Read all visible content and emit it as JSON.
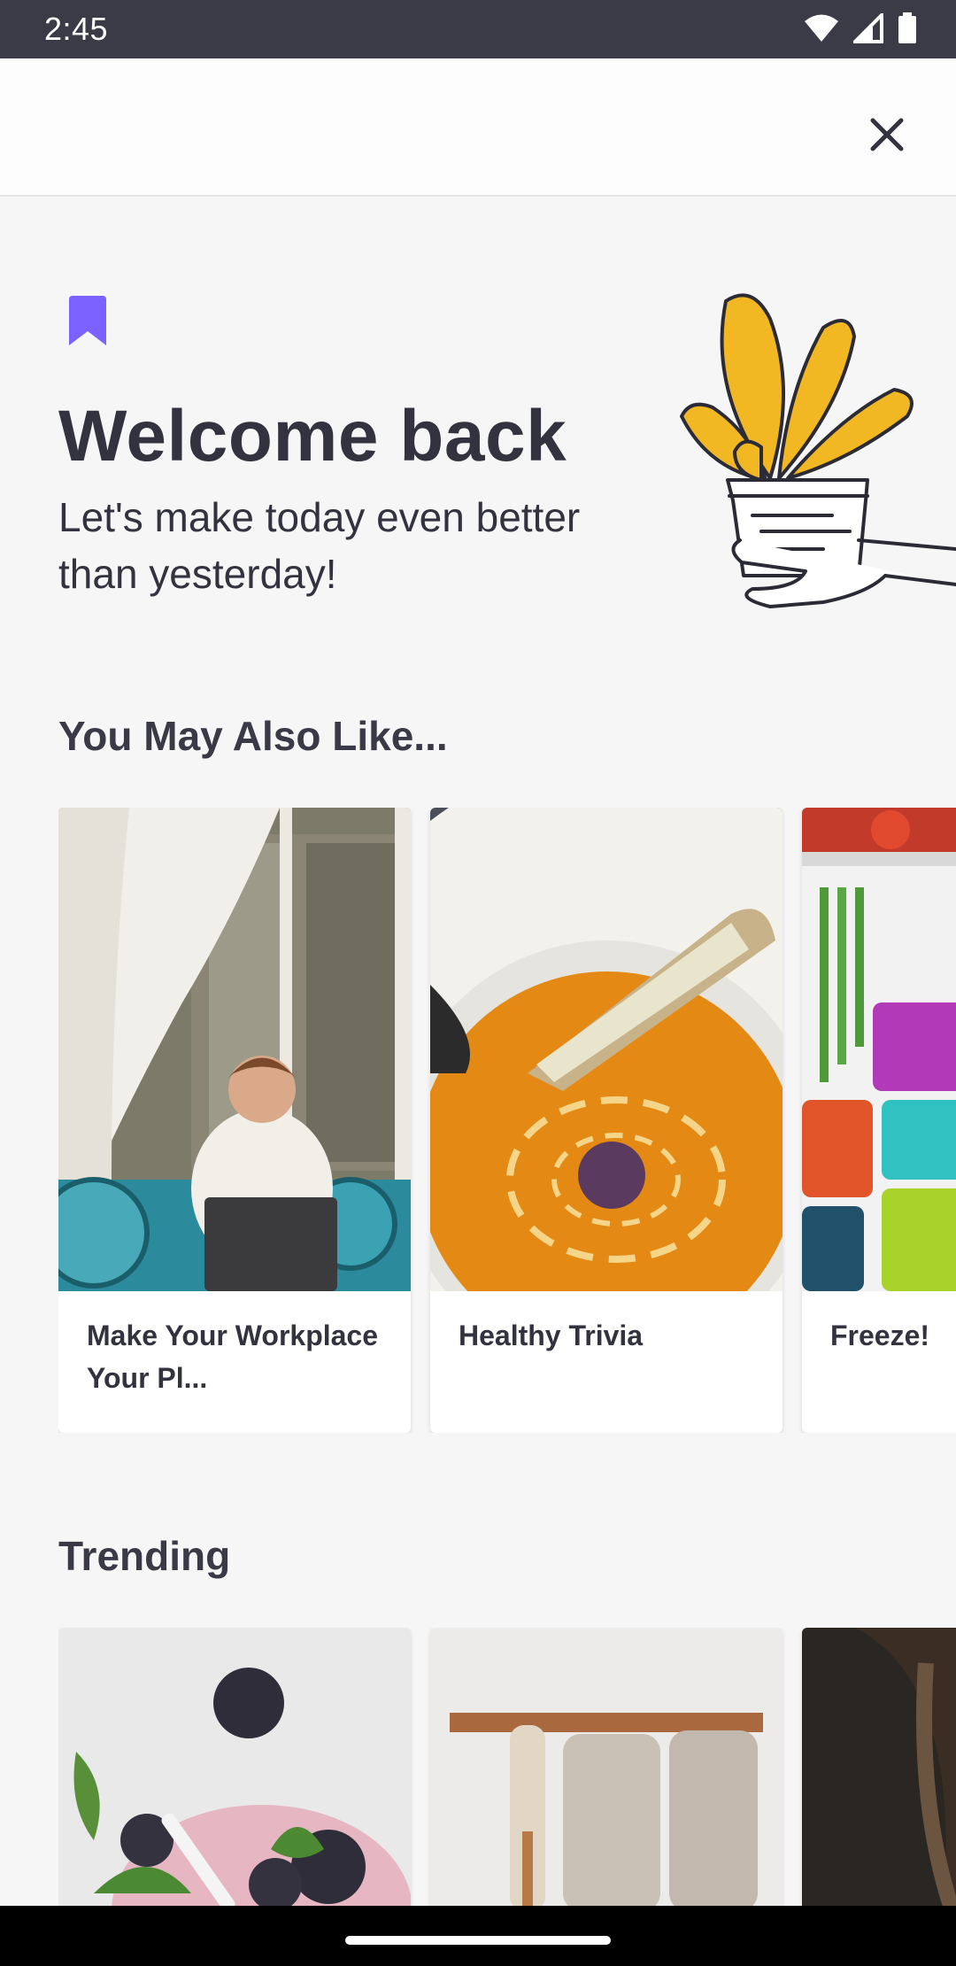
{
  "status_bar": {
    "time": "2:45"
  },
  "header": {
    "close_icon": "close-icon"
  },
  "welcome": {
    "icon": "bookmark-icon",
    "title": "Welcome back",
    "subtitle": "Let's make today even better than yesterday!",
    "accent_color": "#7b61ff"
  },
  "you_may_also_like": {
    "title": "You May Also Like...",
    "cards": [
      {
        "label": "Make Your Workplace Your Pl..."
      },
      {
        "label": "Healthy Trivia"
      },
      {
        "label": "Freeze!"
      }
    ]
  },
  "trending": {
    "title": "Trending"
  }
}
